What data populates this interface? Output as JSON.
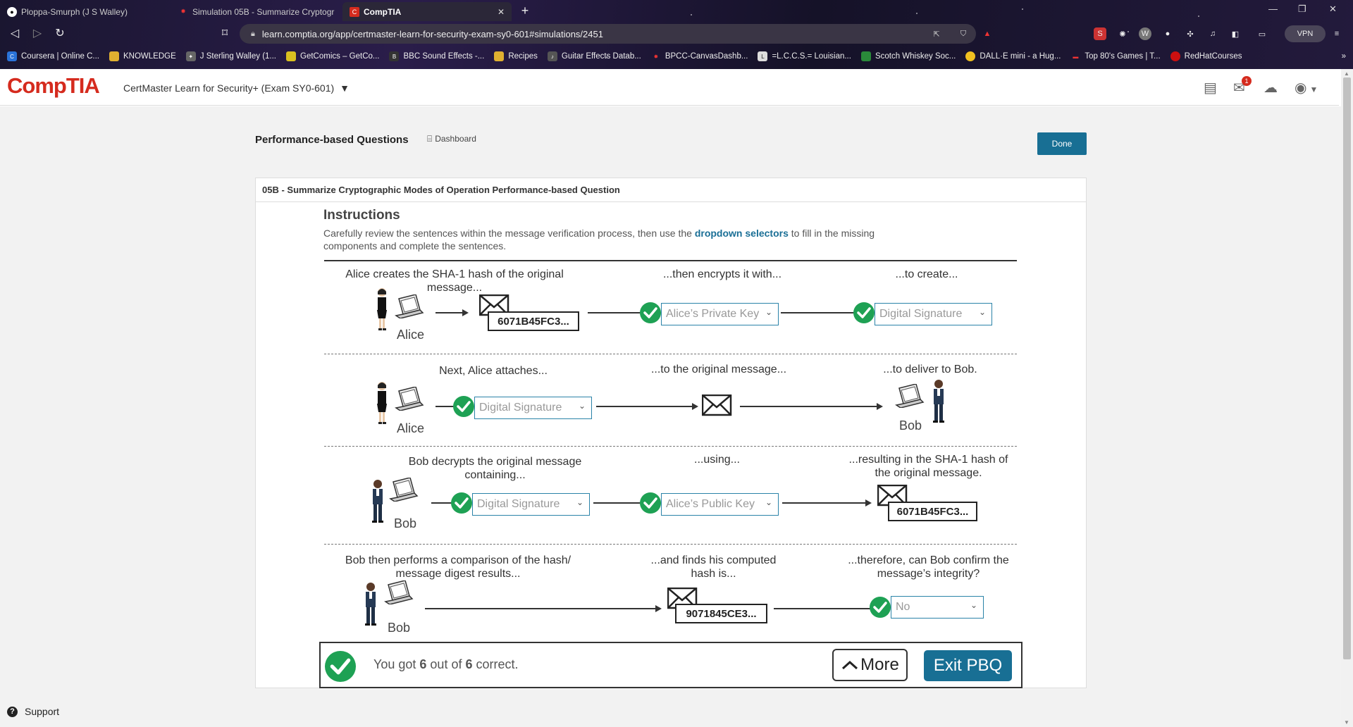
{
  "browser": {
    "tabs": [
      {
        "label": "Ploppa-Smurph (J S Walley)",
        "icon": "github-icon"
      },
      {
        "label": "Simulation 05B - Summarize Cryptogr",
        "icon": "comptia-tab-icon"
      },
      {
        "label": "CompTIA",
        "icon": "comptia-tab-icon"
      }
    ],
    "url": "learn.comptia.org/app/certmaster-learn-for-security-exam-sy0-601#simulations/2451",
    "vpn_label": "VPN",
    "bookmarks": [
      "Coursera | Online C...",
      "KNOWLEDGE",
      "J Sterling Walley (1...",
      "GetComics – GetCo...",
      "BBC Sound Effects -...",
      "Recipes",
      "Guitar Effects Datab...",
      "BPCC-CanvasDashb...",
      "=L.C.C.S.= Louisian...",
      "Scotch Whiskey Soc...",
      "DALL·E mini - a Hug...",
      "Top 80's Games | T...",
      "RedHatCourses"
    ]
  },
  "app": {
    "logo": "CompTIA",
    "course": "CertMaster Learn for Security+ (Exam SY0-601)",
    "mail_badge": "1"
  },
  "page": {
    "title": "Performance-based Questions",
    "dashboard_label": "Dashboard",
    "done_label": "Done",
    "question_title": "05B - Summarize Cryptographic Modes of Operation Performance-based Question",
    "instructions_heading": "Instructions",
    "instructions_pre": "Carefully review the sentences within the message verification process, then use the ",
    "instructions_kw": "dropdown selectors",
    "instructions_post": " to fill in the missing components and complete the sentences."
  },
  "rows": {
    "r1": {
      "c1": "Alice creates the SHA-1 hash of the original message...",
      "c2": "...then encrypts it with...",
      "c3": "...to create...",
      "person": "Alice",
      "hash": "6071B45FC3...",
      "sel1": "Alice’s Private Key",
      "sel2": "Digital Signature"
    },
    "r2": {
      "c1": "Next, Alice attaches...",
      "c2": "...to the original message...",
      "c3": "...to deliver to Bob.",
      "person_left": "Alice",
      "person_right": "Bob",
      "sel1": "Digital Signature"
    },
    "r3": {
      "c1": "Bob decrypts the original message containing...",
      "c2": "...using...",
      "c3": "...resulting in the SHA-1 hash of the original message.",
      "person": "Bob",
      "sel1": "Digital Signature",
      "sel2": "Alice’s Public Key",
      "hash": "6071B45FC3..."
    },
    "r4": {
      "c1": "Bob then performs a comparison of the hash/ message digest results...",
      "c2": "...and finds his computed hash is...",
      "c3": "...therefore, can Bob confirm the message’s integrity?",
      "person": "Bob",
      "hash": "9071845CE3...",
      "sel1": "No"
    }
  },
  "result": {
    "pre": "You got ",
    "score": "6",
    "mid": " out of ",
    "total": "6",
    "post": " correct.",
    "more_label": "More",
    "exit_label": "Exit PBQ"
  },
  "support_label": "Support",
  "colors": {
    "brand_red": "#d52b1e",
    "accent_blue": "#186f94",
    "check_green": "#1ea154"
  }
}
